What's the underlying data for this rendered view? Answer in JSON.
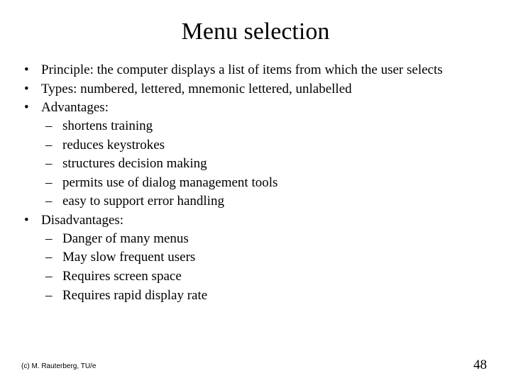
{
  "title": "Menu selection",
  "bullets": {
    "principle": "Principle:  the computer displays a list of items from which the user selects",
    "types": "Types:  numbered, lettered, mnemonic lettered, unlabelled",
    "advantages_label": "Advantages:",
    "advantages": [
      "shortens training",
      "reduces keystrokes",
      "structures decision making",
      "permits use of dialog management tools",
      "easy to support error handling"
    ],
    "disadvantages_label": "Disadvantages:",
    "disadvantages": [
      "Danger of many menus",
      "May slow frequent users",
      "Requires screen space",
      "Requires rapid display rate"
    ]
  },
  "footer": {
    "left": "(c) M. Rauterberg, TU/e",
    "page": "48"
  }
}
